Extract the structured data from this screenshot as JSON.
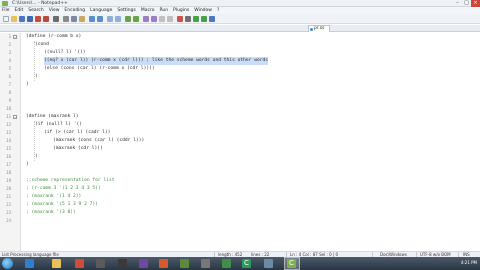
{
  "window": {
    "title": "C:\\Users\\... - Notepad++"
  },
  "menu": [
    "File",
    "Edit",
    "Search",
    "View",
    "Encoding",
    "Language",
    "Settings",
    "Macro",
    "Run",
    "Plugins",
    "Window",
    "?"
  ],
  "tab": {
    "label": "pr.ss"
  },
  "code_lines": [
    {
      "n": "1",
      "fold": "-",
      "indent": 0,
      "text": "(define (r-comm b x)"
    },
    {
      "n": "2",
      "fold": "",
      "indent": 1,
      "text": "(cond"
    },
    {
      "n": "3",
      "fold": "",
      "indent": 2,
      "text": "((null? l) '())"
    },
    {
      "n": "4",
      "fold": "",
      "indent": 2,
      "text": "((eq? x (car l)) (r-comm x (cdr l))) ; like the scheme words and this other words",
      "highlight": true
    },
    {
      "n": "5",
      "fold": "",
      "indent": 2,
      "text": "(else (cons (car l) (r-comm x (cdr l))))"
    },
    {
      "n": "6",
      "fold": "",
      "indent": 1,
      "text": ")"
    },
    {
      "n": "7",
      "fold": "",
      "indent": 0,
      "text": ")"
    },
    {
      "n": "8",
      "fold": "",
      "indent": 0,
      "text": ""
    },
    {
      "n": "9",
      "fold": "",
      "indent": 0,
      "text": ""
    },
    {
      "n": "10",
      "fold": "",
      "indent": 0,
      "text": ""
    },
    {
      "n": "11",
      "fold": "-",
      "indent": 0,
      "text": "(define (maxrank l)"
    },
    {
      "n": "12",
      "fold": "",
      "indent": 1,
      "text": "(if (null? l) '()"
    },
    {
      "n": "13",
      "fold": "",
      "indent": 2,
      "text": "(if (> (car l) (cadr l))"
    },
    {
      "n": "14",
      "fold": "",
      "indent": 3,
      "text": "(maxrank (cons (car l) (cddr l)))"
    },
    {
      "n": "15",
      "fold": "",
      "indent": 3,
      "text": "(maxrank (cdr l)))"
    },
    {
      "n": "16",
      "fold": "",
      "indent": 1,
      "text": ")"
    },
    {
      "n": "17",
      "fold": "",
      "indent": 0,
      "text": ")"
    },
    {
      "n": "18",
      "fold": "",
      "indent": 0,
      "text": ""
    },
    {
      "n": "19",
      "fold": "",
      "indent": 0,
      "text": ";;scheme representation for list"
    },
    {
      "n": "20",
      "fold": "",
      "indent": 0,
      "text": "; (r-comm 3 '(1 2 3 4 3 5))"
    },
    {
      "n": "21",
      "fold": "",
      "indent": 0,
      "text": "; (maxrank '(1 4 2))"
    },
    {
      "n": "22",
      "fold": "",
      "indent": 0,
      "text": "; (maxrank '(5 1 3 9 2 7))"
    },
    {
      "n": "23",
      "fold": "",
      "indent": 0,
      "text": "; (maxrank '(3 8))"
    },
    {
      "n": "24",
      "fold": "",
      "indent": 0,
      "text": ""
    }
  ],
  "status": {
    "file_type": "List Processing language file",
    "length": "length : 452",
    "lines": "lines : 22",
    "position": "Ln : 4    Col : 87    Sel : 0 | 0",
    "eol": "Dos\\Windows",
    "encoding": "UTF-8 w/o BOM",
    "mode": "INS"
  },
  "taskbar": {
    "clock": "4:21 PM"
  },
  "colors": {
    "keyword": "#1a3f9c",
    "selection": "#c9ddf7",
    "tab_dot": "#3f8fd8"
  }
}
